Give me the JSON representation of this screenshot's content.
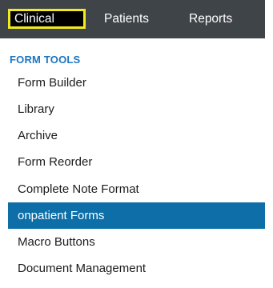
{
  "tabs": [
    {
      "label": "Clinical",
      "selected": true
    },
    {
      "label": "Patients",
      "selected": false
    },
    {
      "label": "Reports",
      "selected": false
    }
  ],
  "menu": {
    "section_heading": "FORM TOOLS",
    "items": [
      {
        "label": "Form Builder",
        "active": false
      },
      {
        "label": "Library",
        "active": false
      },
      {
        "label": "Archive",
        "active": false
      },
      {
        "label": "Form Reorder",
        "active": false
      },
      {
        "label": "Complete Note Format",
        "active": false
      },
      {
        "label": "onpatient Forms",
        "active": true
      },
      {
        "label": "Macro Buttons",
        "active": false
      },
      {
        "label": "Document Management",
        "active": false
      }
    ]
  },
  "colors": {
    "topbar": "#3f4449",
    "selected_tab_bg": "#000000",
    "selected_tab_border": "#f1ea1f",
    "section_heading": "#1a75c2",
    "active_item_bg": "#0d6ea8",
    "item_text": "#1c1c1c"
  }
}
